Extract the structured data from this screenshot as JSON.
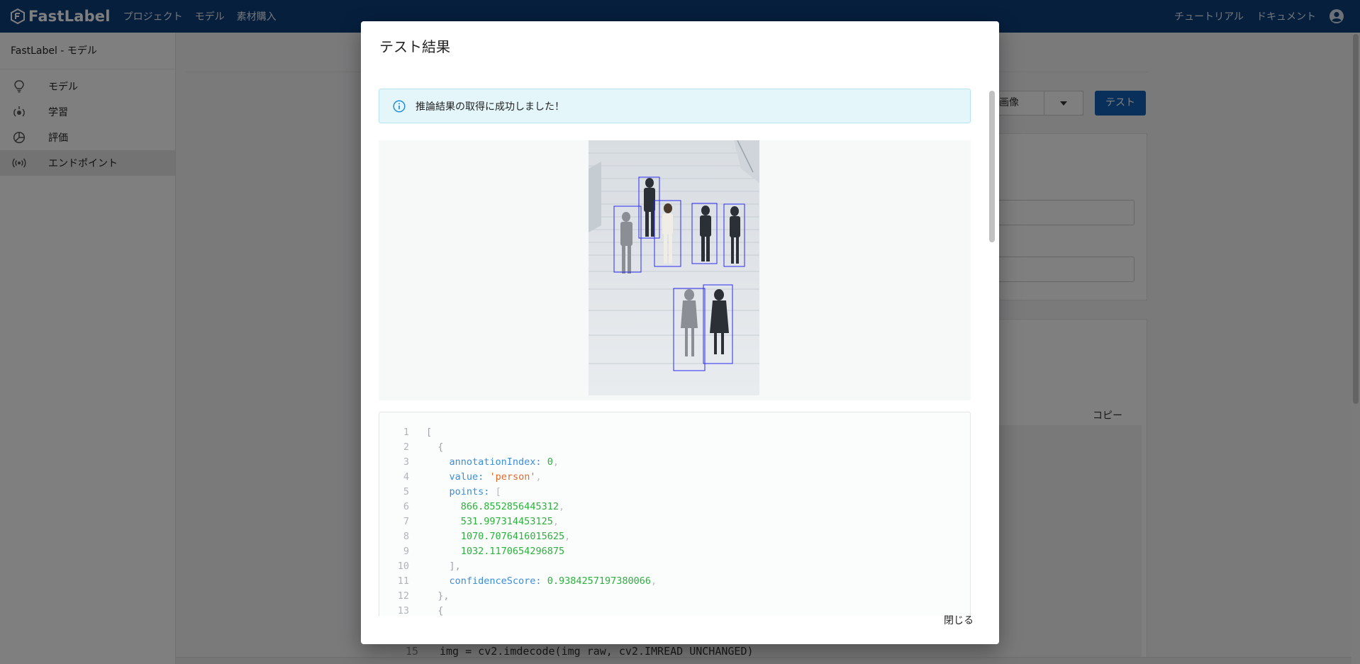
{
  "header": {
    "logo_text": "FastLabel",
    "nav": [
      "プロジェクト",
      "モデル",
      "素材購入"
    ],
    "right_links": [
      "チュートリアル",
      "ドキュメント"
    ]
  },
  "sidebar": {
    "title": "FastLabel - モデル",
    "items": [
      {
        "label": "モデル",
        "icon": "lightbulb-icon"
      },
      {
        "label": "学習",
        "icon": "training-icon"
      },
      {
        "label": "評価",
        "icon": "pie-chart-icon"
      },
      {
        "label": "エンドポイント",
        "icon": "broadcast-icon",
        "active": true
      }
    ]
  },
  "background": {
    "select_value": "ル画像",
    "test_button": "テスト",
    "copy_label": "コピー",
    "code_line_number": "15",
    "code_line": "img = cv2.imdecode(img_raw, cv2.IMREAD_UNCHANGED)"
  },
  "modal": {
    "title": "テスト結果",
    "alert": "推論結果の取得に成功しました！",
    "close_label": "閉じる",
    "code_lines": [
      {
        "no": "1",
        "text": "["
      },
      {
        "no": "2",
        "text": "  {"
      },
      {
        "no": "3",
        "key": "annotationIndex",
        "value": "0",
        "type": "num"
      },
      {
        "no": "4",
        "key": "value",
        "value": "'person'",
        "type": "str"
      },
      {
        "no": "5",
        "key": "points",
        "value": "[",
        "type": "punct"
      },
      {
        "no": "6",
        "value": "866.8552856445312",
        "type": "num",
        "indent": 2,
        "comma": true
      },
      {
        "no": "7",
        "value": "531.997314453125",
        "type": "num",
        "indent": 2,
        "comma": true
      },
      {
        "no": "8",
        "value": "1070.7076416015625",
        "type": "num",
        "indent": 2,
        "comma": true
      },
      {
        "no": "9",
        "value": "1032.1170654296875",
        "type": "num",
        "indent": 2,
        "comma": false
      },
      {
        "no": "10",
        "text": "    ],"
      },
      {
        "no": "11",
        "key": "confidenceScore",
        "value": "0.9384257197380066",
        "type": "num"
      },
      {
        "no": "12",
        "text": "  },"
      },
      {
        "no": "13",
        "text": "  {"
      }
    ]
  },
  "colors": {
    "header_bg": "#0d3e7a",
    "primary": "#1360b6",
    "alert_bg": "#e5f6fb",
    "bbox": "#2a2af0"
  }
}
